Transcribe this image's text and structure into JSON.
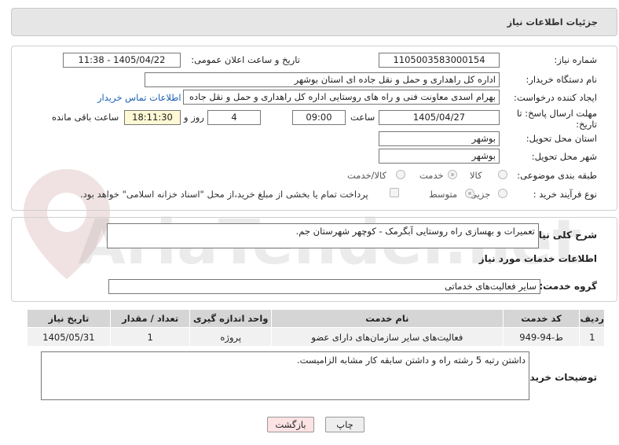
{
  "header": {
    "title": "جزئیات اطلاعات نیاز"
  },
  "form": {
    "need_number_label": "شماره نیاز:",
    "need_number": "1105003583000154",
    "announce_label": "تاریخ و ساعت اعلان عمومی:",
    "announce_value": "1405/04/22 - 11:38",
    "buyer_org_label": "نام دستگاه خریدار:",
    "buyer_org": "اداره کل راهداری و حمل و نقل جاده ای استان بوشهر",
    "creator_label": "ایجاد کننده درخواست:",
    "creator": "بهرام اسدی معاونت فنی و راه های روستایی اداره کل راهداری و حمل و نقل جاده",
    "contact_link": "اطلاعات تماس خریدار",
    "deadline_label": "مهلت ارسال پاسخ: تا تاریخ:",
    "deadline_date": "1405/04/27",
    "time_label": "ساعت",
    "deadline_time": "09:00",
    "days_value": "4",
    "days_label": "روز و",
    "remaining_time": "18:11:30",
    "remaining_label": "ساعت باقی مانده",
    "province_label": "استان محل تحویل:",
    "province": "بوشهر",
    "city_label": "شهر محل تحویل:",
    "city": "بوشهر",
    "category_label": "طبقه بندی موضوعی:",
    "category_options": [
      "کالا",
      "خدمت",
      "کالا/خدمت"
    ],
    "category_selected": "خدمت",
    "process_label": "نوع فرآیند خرید :",
    "process_options": [
      "جزیی",
      "متوسط"
    ],
    "process_selected": "متوسط",
    "payment_note": "پرداخت تمام یا بخشی از مبلغ خرید،از محل \"اسناد خزانه اسلامی\" خواهد بود."
  },
  "summary": {
    "label": "شرح کلی نیاز:",
    "text": "تعمیرات و بهسازی راه روستایی آبگرمک - کوچهر شهرستان جم."
  },
  "services": {
    "section_title": "اطلاعات خدمات مورد نیاز",
    "group_label": "گروه خدمت:",
    "group_value": "سایر فعالیت‌های خدماتی",
    "columns": [
      "ردیف",
      "کد خدمت",
      "نام خدمت",
      "واحد اندازه گیری",
      "تعداد / مقدار",
      "تاریخ نیاز"
    ],
    "rows": [
      [
        "1",
        "ط-94-949",
        "فعالیت‌های سایر سازمان‌های دارای عضو",
        "پروژه",
        "1",
        "1405/05/31"
      ]
    ]
  },
  "buyer_notes": {
    "label": "توضیحات خریدار:",
    "text": "داشتن رتبه 5 رشته راه و داشتن سابقه کار مشابه الزامیست."
  },
  "buttons": {
    "print": "چاپ",
    "back": "بازگشت"
  },
  "watermark": {
    "text": "AriaTender.net"
  },
  "colors": {
    "accent_link": "#1a5fb4",
    "back_button_bg": "#fde3e3",
    "print_button_bg": "#eeeeee",
    "highlight_box": "#fff8d4"
  }
}
